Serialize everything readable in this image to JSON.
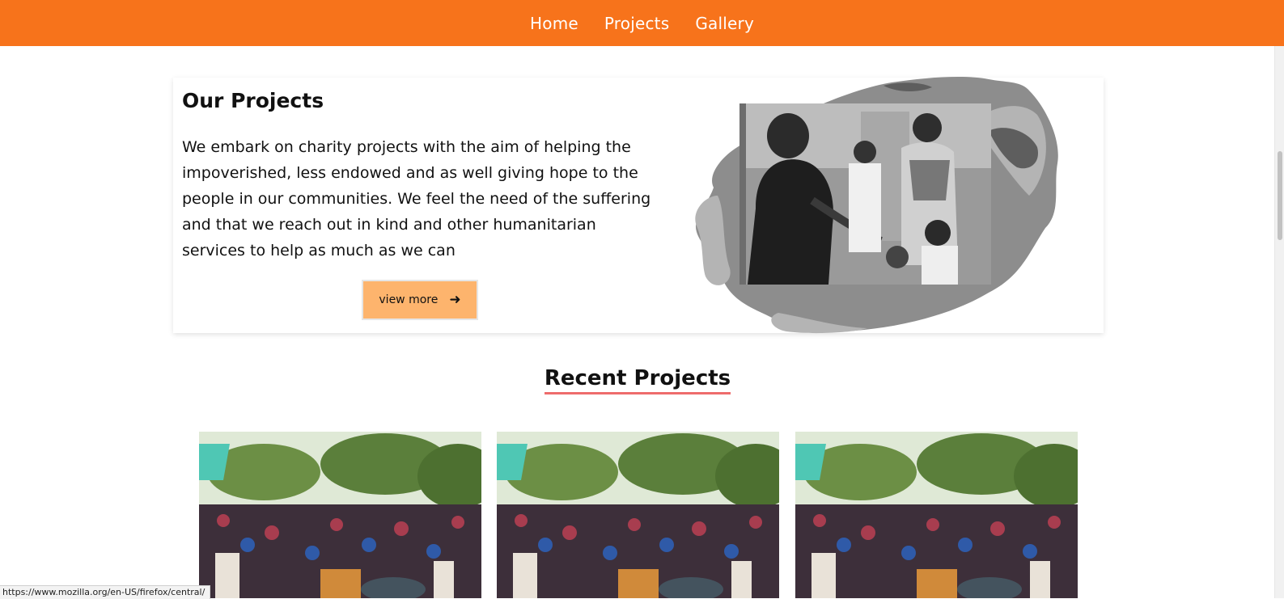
{
  "nav": {
    "items": [
      {
        "label": "Home"
      },
      {
        "label": "Projects"
      },
      {
        "label": "Gallery"
      }
    ],
    "background": "#f7731b"
  },
  "intro": {
    "title": "Our Projects",
    "text": "We embark on charity projects with the aim of helping the impoverished, less endowed and as well giving hope to the people in our communities. We feel the need of the suffering and that we reach out in kind and other humanitarian services to help as much as we can",
    "button_label": "view more",
    "button_icon": "arrow-right-icon",
    "button_color": "#fdb46d"
  },
  "recent": {
    "title": "Recent Projects",
    "underline_color": "#ee6c6c",
    "projects": [
      {
        "image": "group-photo"
      },
      {
        "image": "group-photo"
      },
      {
        "image": "group-photo"
      }
    ]
  },
  "statusbar": {
    "url": "https://www.mozilla.org/en-US/firefox/central/"
  }
}
